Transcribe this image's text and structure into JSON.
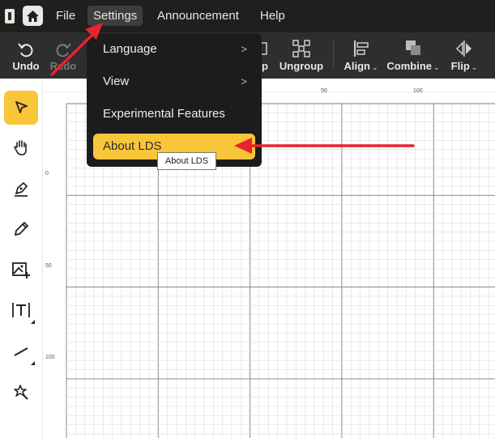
{
  "menubar": {
    "items": [
      {
        "label": "File"
      },
      {
        "label": "Settings"
      },
      {
        "label": "Announcement"
      },
      {
        "label": "Help"
      }
    ],
    "active": "Settings"
  },
  "toolbar": {
    "undo": "Undo",
    "redo": "Redo",
    "group_partial": "up",
    "ungroup": "Ungroup",
    "align": "Align",
    "combine": "Combine",
    "flip": "Flip"
  },
  "left_toolbar": {
    "tools": [
      "select-tool",
      "hand-tool",
      "pen-tool",
      "pencil-tool",
      "image-tool",
      "text-tool",
      "line-tool",
      "magic-tool"
    ],
    "active": "select-tool"
  },
  "settings_menu": {
    "items": [
      {
        "label": "Language",
        "submenu": true
      },
      {
        "label": "View",
        "submenu": true
      },
      {
        "label": "Experimental Features",
        "submenu": false
      },
      {
        "label": "About LDS",
        "submenu": false
      }
    ],
    "highlighted": "About LDS"
  },
  "tooltip": {
    "text": "About LDS"
  },
  "rulers": {
    "horizontal": [
      "50",
      "100"
    ],
    "vertical": [
      "0",
      "50",
      "100"
    ]
  },
  "colors": {
    "accent": "#f9c63a",
    "menubar_bg": "#1f1f1f",
    "toolbar_bg": "#2e2e2e",
    "dropdown_bg": "#1c1c1c",
    "annotation_arrow": "#e8222e"
  },
  "icons": {
    "home": "home-icon",
    "undo": "undo-icon",
    "redo": "redo-icon",
    "ungroup": "ungroup-icon",
    "align": "align-left-icon",
    "combine": "combine-icon",
    "flip": "flip-icon",
    "submenu": "chevron-right-icon"
  }
}
